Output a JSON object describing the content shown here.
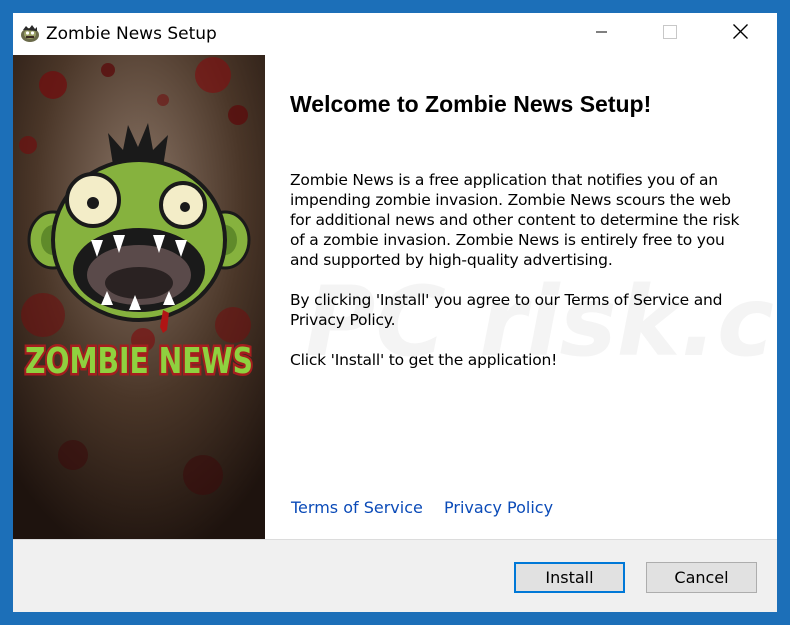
{
  "window": {
    "title": "Zombie News Setup",
    "app_icon": "zombie-app-icon",
    "controls": {
      "minimize_icon": "minimize-icon",
      "maximize_icon": "maximize-icon",
      "close_icon": "close-icon"
    }
  },
  "sidebar": {
    "logo_text": "ZOMBIE NEWS"
  },
  "content": {
    "heading": "Welcome to Zombie News Setup!",
    "paragraph_1": "Zombie News is a free application that notifies you of an impending zombie invasion. Zombie News scours the web for additional news and other content to determine the risk of a zombie invasion. Zombie News is entirely free to you and supported by high-quality advertising.",
    "paragraph_2": "By clicking 'Install' you agree to our Terms of Service and Privacy Policy.",
    "paragraph_3": "Click 'Install' to get the application!",
    "watermark": "PC risk.com",
    "links": {
      "terms": "Terms of Service",
      "privacy": "Privacy Policy"
    }
  },
  "footer": {
    "install_label": "Install",
    "cancel_label": "Cancel"
  },
  "colors": {
    "accent": "#0078d7",
    "window_border": "#1c6fb8",
    "link": "#0b4bb8",
    "logo_text_fill": "#8fd13f",
    "logo_text_outline": "#a41e1e"
  }
}
